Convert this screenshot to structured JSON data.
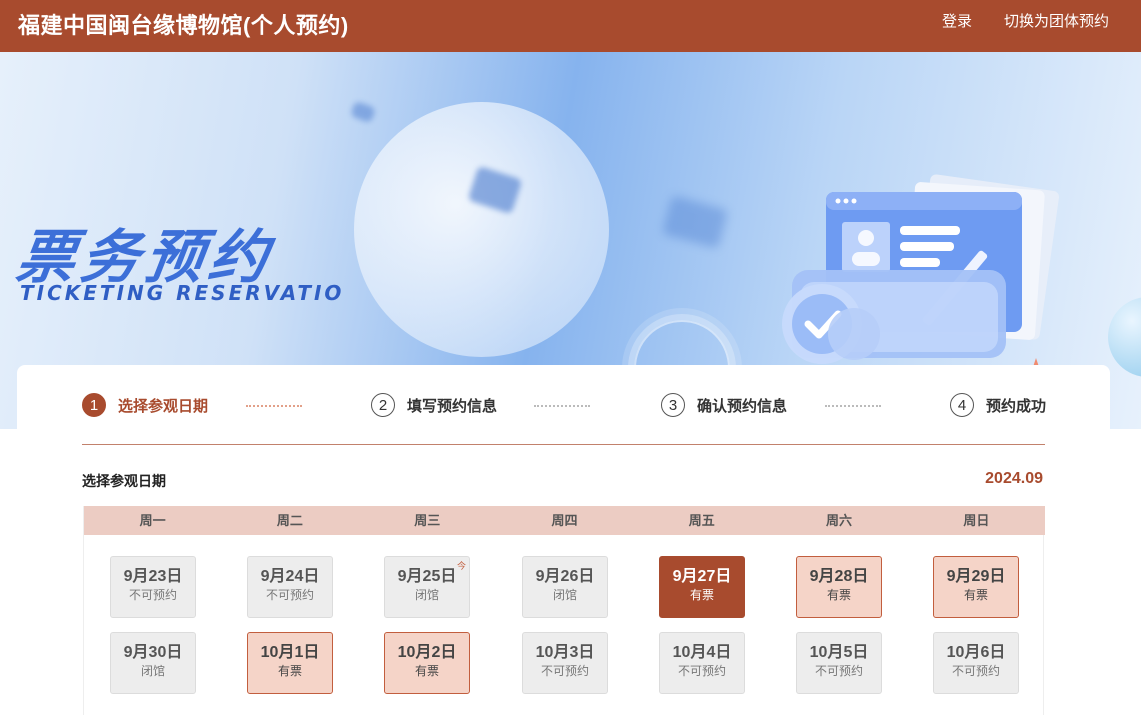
{
  "header": {
    "title": "福建中国闽台缘博物馆(个人预约)",
    "login": "登录",
    "switch_group": "切换为团体预约",
    "bg_color": "#a84b2e"
  },
  "banner": {
    "title_cn": "票务预约",
    "title_en": "TICKETING RESERVATIO"
  },
  "steps": [
    {
      "num": "1",
      "label": "选择参观日期",
      "active": true
    },
    {
      "num": "2",
      "label": "填写预约信息",
      "active": false
    },
    {
      "num": "3",
      "label": "确认预约信息",
      "active": false
    },
    {
      "num": "4",
      "label": "预约成功",
      "active": false
    }
  ],
  "calendar": {
    "section_title": "选择参观日期",
    "month": "2024.09",
    "weekdays": [
      "周一",
      "周二",
      "周三",
      "周四",
      "周五",
      "周六",
      "周日"
    ],
    "today_mark": "今",
    "rows": [
      [
        {
          "date": "9月23日",
          "status": "不可预约",
          "state": "unavailable"
        },
        {
          "date": "9月24日",
          "status": "不可预约",
          "state": "unavailable"
        },
        {
          "date": "9月25日",
          "status": "闭馆",
          "state": "unavailable",
          "today": true
        },
        {
          "date": "9月26日",
          "status": "闭馆",
          "state": "unavailable"
        },
        {
          "date": "9月27日",
          "status": "有票",
          "state": "selected"
        },
        {
          "date": "9月28日",
          "status": "有票",
          "state": "available"
        },
        {
          "date": "9月29日",
          "status": "有票",
          "state": "available"
        }
      ],
      [
        {
          "date": "9月30日",
          "status": "闭馆",
          "state": "unavailable"
        },
        {
          "date": "10月1日",
          "status": "有票",
          "state": "available"
        },
        {
          "date": "10月2日",
          "status": "有票",
          "state": "available"
        },
        {
          "date": "10月3日",
          "status": "不可预约",
          "state": "unavailable"
        },
        {
          "date": "10月4日",
          "status": "不可预约",
          "state": "unavailable"
        },
        {
          "date": "10月5日",
          "status": "不可预约",
          "state": "unavailable"
        },
        {
          "date": "10月6日",
          "status": "不可预约",
          "state": "unavailable"
        }
      ]
    ]
  },
  "colors": {
    "accent": "#a84b2e",
    "available_bg": "#f5d4c8",
    "unavailable_bg": "#ededed",
    "weekbar_bg": "#ecccc3"
  }
}
